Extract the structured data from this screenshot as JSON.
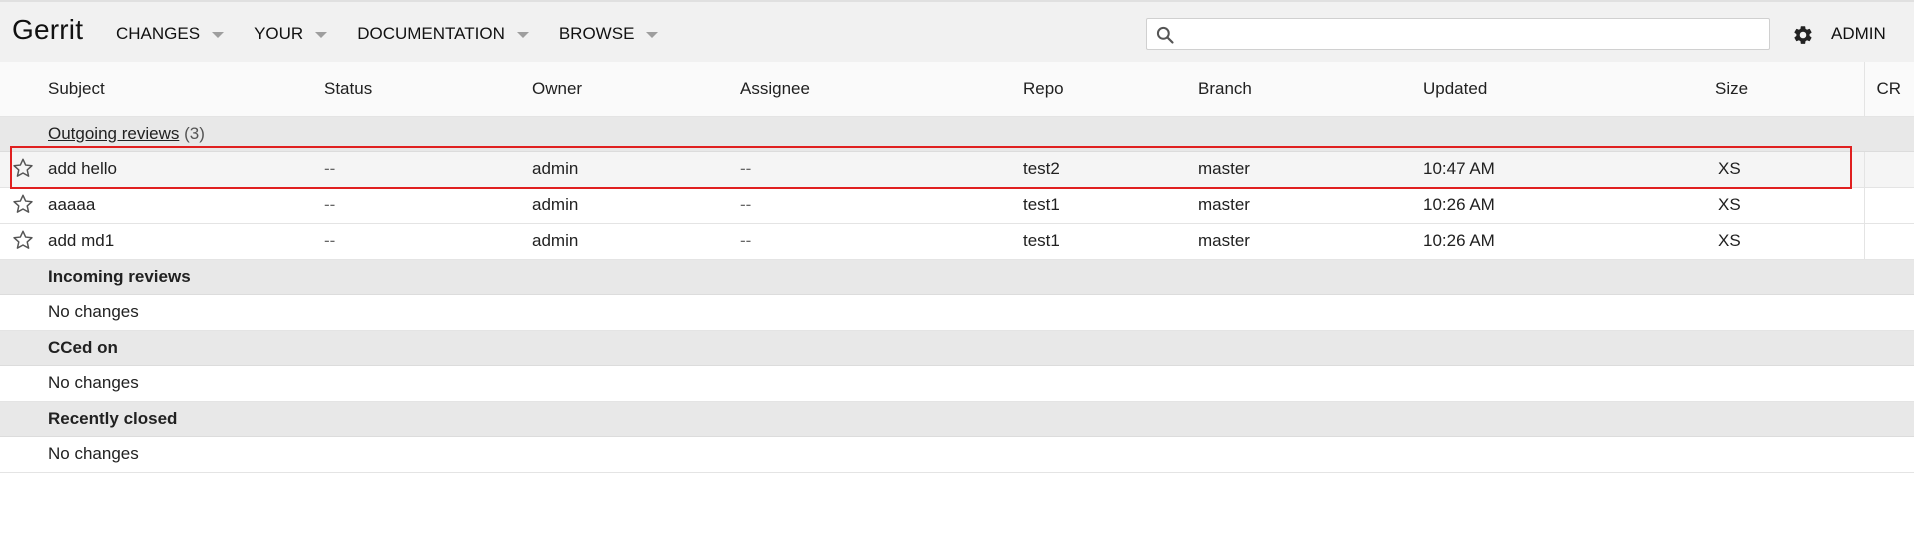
{
  "app": {
    "name": "Gerrit",
    "nav": [
      {
        "label": "CHANGES"
      },
      {
        "label": "YOUR"
      },
      {
        "label": "DOCUMENTATION"
      },
      {
        "label": "BROWSE"
      }
    ],
    "search": {
      "value": "",
      "placeholder": ""
    },
    "account_label": "ADMIN"
  },
  "table": {
    "headers": {
      "subject": "Subject",
      "status": "Status",
      "owner": "Owner",
      "assignee": "Assignee",
      "repo": "Repo",
      "branch": "Branch",
      "updated": "Updated",
      "size": "Size",
      "cr": "CR"
    },
    "sections": {
      "outgoing": {
        "title": "Outgoing reviews",
        "count": "(3)"
      },
      "incoming": {
        "title": "Incoming reviews",
        "empty": "No changes"
      },
      "cced": {
        "title": "CCed on",
        "empty": "No changes"
      },
      "closed": {
        "title": "Recently closed",
        "empty": "No changes"
      }
    },
    "rows": [
      {
        "subject": "add hello",
        "status": "--",
        "owner": "admin",
        "assignee": "--",
        "repo": "test2",
        "branch": "master",
        "updated": "10:47 AM",
        "size": "XS"
      },
      {
        "subject": "aaaaa",
        "status": "--",
        "owner": "admin",
        "assignee": "--",
        "repo": "test1",
        "branch": "master",
        "updated": "10:26 AM",
        "size": "XS"
      },
      {
        "subject": "add md1",
        "status": "--",
        "owner": "admin",
        "assignee": "--",
        "repo": "test1",
        "branch": "master",
        "updated": "10:26 AM",
        "size": "XS"
      }
    ]
  },
  "colors": {
    "header_bg": "#f1f1f1",
    "section_bg": "#e8e8e8",
    "highlight_border": "#e02020"
  },
  "icons": {
    "search": "search-icon",
    "settings": "gear-icon",
    "star": "star-outline-icon"
  }
}
